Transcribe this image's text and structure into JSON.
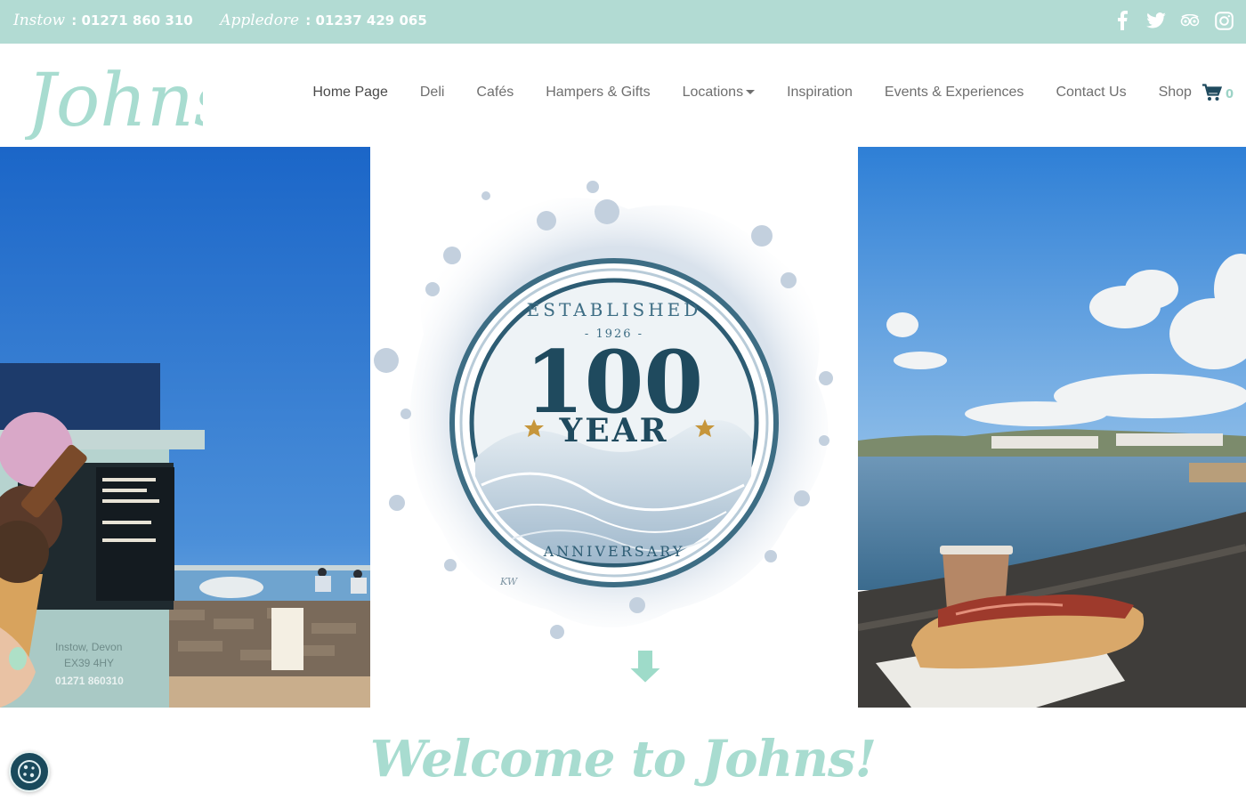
{
  "topbar": {
    "phones": [
      {
        "location": "Instow",
        "separator": " : ",
        "number": "01271 860 310"
      },
      {
        "location": "Appledore",
        "separator": " : ",
        "number": "01237 429 065"
      }
    ],
    "social": [
      "facebook-icon",
      "twitter-icon",
      "tripadvisor-icon",
      "instagram-icon"
    ]
  },
  "header": {
    "logo_text": "Johns",
    "nav": [
      {
        "label": "Home Page"
      },
      {
        "label": "Deli"
      },
      {
        "label": "Cafés"
      },
      {
        "label": "Hampers & Gifts"
      },
      {
        "label": "Locations"
      },
      {
        "label": "Inspiration"
      },
      {
        "label": "Events & Experiences"
      },
      {
        "label": "Contact Us"
      },
      {
        "label": "Shop"
      }
    ],
    "cart_count": "0"
  },
  "hero": {
    "badge": {
      "established": "ESTABLISHED",
      "year": "- 1926 -",
      "number": "100",
      "word": "YEAR",
      "anniversary": "ANNIVERSARY",
      "signature": "KW"
    },
    "left_sign": {
      "line1": "Instow, Devon",
      "line2": "EX39 4HY",
      "phone": "01271 860310"
    }
  },
  "welcome": {
    "title": "Welcome to Johns!"
  },
  "colors": {
    "accent": "#b2dbd3",
    "brand_text": "#a8dcd0",
    "nav_text": "#6f6f6f",
    "badge_dark": "#1f4a5e"
  }
}
